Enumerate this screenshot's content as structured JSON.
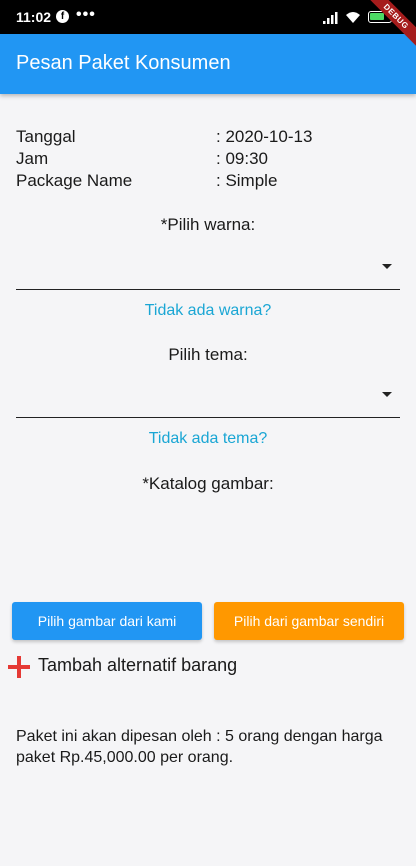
{
  "statusbar": {
    "time": "11:02",
    "dots": "•••",
    "battery_level": "59"
  },
  "debug_banner": "DEBUG",
  "appbar": {
    "title": "Pesan Paket Konsumen"
  },
  "info": {
    "rows": [
      {
        "label": "Tanggal",
        "value": ": 2020-10-13"
      },
      {
        "label": "Jam",
        "value": ": 09:30"
      },
      {
        "label": "Package Name",
        "value": ": Simple"
      }
    ]
  },
  "warna": {
    "label": "*Pilih warna:",
    "value": "",
    "link": "Tidak ada warna?"
  },
  "tema": {
    "label": "Pilih tema:",
    "value": "",
    "link": "Tidak ada tema?"
  },
  "katalog": {
    "label": "*Katalog gambar:"
  },
  "buttons": {
    "from_us": "Pilih gambar dari kami",
    "own": "Pilih dari gambar sendiri"
  },
  "add_alternative": "Tambah alternatif barang",
  "footer": "Paket ini akan dipesan oleh : 5 orang dengan harga paket Rp.45,000.00 per orang.",
  "colors": {
    "primary": "#2196f3",
    "accent": "#ff9800",
    "link": "#1aa6d4",
    "add_icon": "#e53935"
  }
}
